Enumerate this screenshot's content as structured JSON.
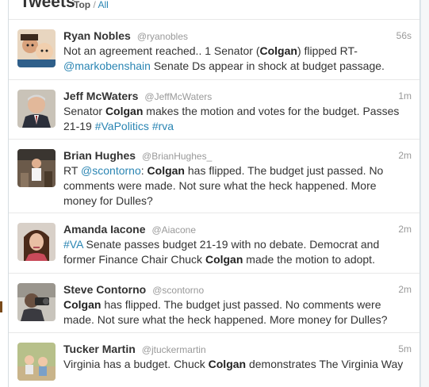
{
  "header": {
    "title": "Tweets",
    "filter_top": "Top",
    "filter_sep": " / ",
    "filter_all": "All"
  },
  "tweets": [
    {
      "name": "Ryan Nobles",
      "handle": "@ryanobles",
      "time": "56s",
      "avatar": "avatar-photo",
      "segments": [
        {
          "t": "text",
          "v": "Not an agreement reached.. 1 Senator ("
        },
        {
          "t": "bold",
          "v": "Colgan"
        },
        {
          "t": "text",
          "v": ") flipped RT-"
        },
        {
          "t": "link",
          "v": "@markobenshain"
        },
        {
          "t": "text",
          "v": " Senate Ds appear in shock at budget passage."
        }
      ]
    },
    {
      "name": "Jeff McWaters",
      "handle": "@JeffMcWaters",
      "time": "1m",
      "avatar": "avatar-photo",
      "segments": [
        {
          "t": "text",
          "v": "Senator "
        },
        {
          "t": "bold",
          "v": "Colgan"
        },
        {
          "t": "text",
          "v": " makes the motion and votes for the budget. Passes 21-19 "
        },
        {
          "t": "link",
          "v": "#VaPolitics"
        },
        {
          "t": "text",
          "v": " "
        },
        {
          "t": "link",
          "v": "#rva"
        }
      ]
    },
    {
      "name": "Brian Hughes",
      "handle": "@BrianHughes_",
      "time": "2m",
      "avatar": "avatar-photo",
      "segments": [
        {
          "t": "text",
          "v": "RT "
        },
        {
          "t": "link",
          "v": "@scontorno"
        },
        {
          "t": "text",
          "v": ": "
        },
        {
          "t": "bold",
          "v": "Colgan"
        },
        {
          "t": "text",
          "v": " has flipped. The budget just passed. No comments were made. Not sure what the heck happened. More money for Dulles?"
        }
      ]
    },
    {
      "name": "Amanda Iacone",
      "handle": "@Aiacone",
      "time": "2m",
      "avatar": "avatar-photo",
      "segments": [
        {
          "t": "link",
          "v": "#VA"
        },
        {
          "t": "text",
          "v": " Senate passes budget 21-19 with no debate. Democrat and former Finance Chair Chuck "
        },
        {
          "t": "bold",
          "v": "Colgan"
        },
        {
          "t": "text",
          "v": " made the motion to adopt."
        }
      ]
    },
    {
      "name": "Steve Contorno",
      "handle": "@scontorno",
      "time": "2m",
      "avatar": "avatar-photo",
      "segments": [
        {
          "t": "bold",
          "v": "Colgan"
        },
        {
          "t": "text",
          "v": " has flipped. The budget just passed. No comments were made. Not sure what the heck happened. More money for Dulles?"
        }
      ]
    },
    {
      "name": "Tucker Martin",
      "handle": "@jtuckermartin",
      "time": "5m",
      "avatar": "avatar-photo",
      "segments": [
        {
          "t": "text",
          "v": "Virginia has a budget. Chuck "
        },
        {
          "t": "bold",
          "v": "Colgan"
        },
        {
          "t": "text",
          "v": " demonstrates The Virginia Way"
        }
      ]
    }
  ]
}
